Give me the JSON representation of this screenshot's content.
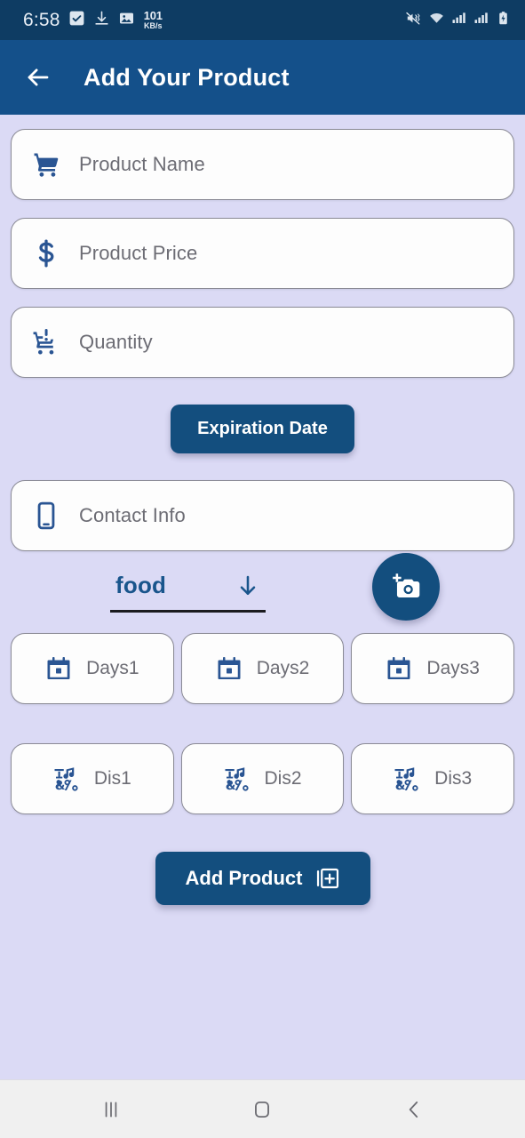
{
  "status_bar": {
    "time": "6:58",
    "network_speed_value": "101",
    "network_speed_unit": "KB/s",
    "left_icons": [
      "checkbox-checked-icon",
      "download-icon",
      "image-icon"
    ],
    "right_icons": [
      "mute-vibrate-icon",
      "wifi-icon",
      "signal-icon-1",
      "signal-icon-2",
      "battery-charging-icon"
    ]
  },
  "app_bar": {
    "back_icon": "back-arrow-icon",
    "title": "Add Your Product"
  },
  "form": {
    "fields": [
      {
        "name": "product-name",
        "placeholder": "Product Name",
        "icon": "shopping-cart-icon"
      },
      {
        "name": "product-price",
        "placeholder": "Product Price",
        "icon": "dollar-sign-icon"
      },
      {
        "name": "quantity",
        "placeholder": "Quantity",
        "icon": "production-quantity-limits-icon"
      },
      {
        "name": "contact-info",
        "placeholder": "Contact Info",
        "icon": "mobile-phone-icon"
      }
    ],
    "expiration_button": {
      "label": "Expiration Date"
    },
    "category_dropdown": {
      "value": "food",
      "icon": "arrow-downward-icon"
    },
    "photo_fab": {
      "icon": "add-a-photo-icon"
    },
    "days_fields": [
      {
        "name": "days1",
        "placeholder": "Days1",
        "icon": "calendar-icon"
      },
      {
        "name": "days2",
        "placeholder": "Days2",
        "icon": "calendar-icon"
      },
      {
        "name": "days3",
        "placeholder": "Days3",
        "icon": "calendar-icon"
      }
    ],
    "discount_fields": [
      {
        "name": "dis1",
        "placeholder": "Dis1",
        "icon": "emoji-symbols-icon"
      },
      {
        "name": "dis2",
        "placeholder": "Dis2",
        "icon": "emoji-symbols-icon"
      },
      {
        "name": "dis3",
        "placeholder": "Dis3",
        "icon": "emoji-symbols-icon"
      }
    ],
    "submit_button": {
      "label": "Add Product",
      "icon": "library-add-icon"
    }
  },
  "nav_bar": {
    "recents_icon": "recents-icon",
    "home_icon": "home-icon",
    "back_icon": "nav-back-icon"
  },
  "colors": {
    "status_bar": "#0e3c63",
    "app_bar": "#14508a",
    "background": "#dbdaf5",
    "accent": "#134e7e",
    "field_background": "#fdfdfd",
    "placeholder_text": "#6c6c74",
    "nav_bar": "#f0f0f0"
  }
}
